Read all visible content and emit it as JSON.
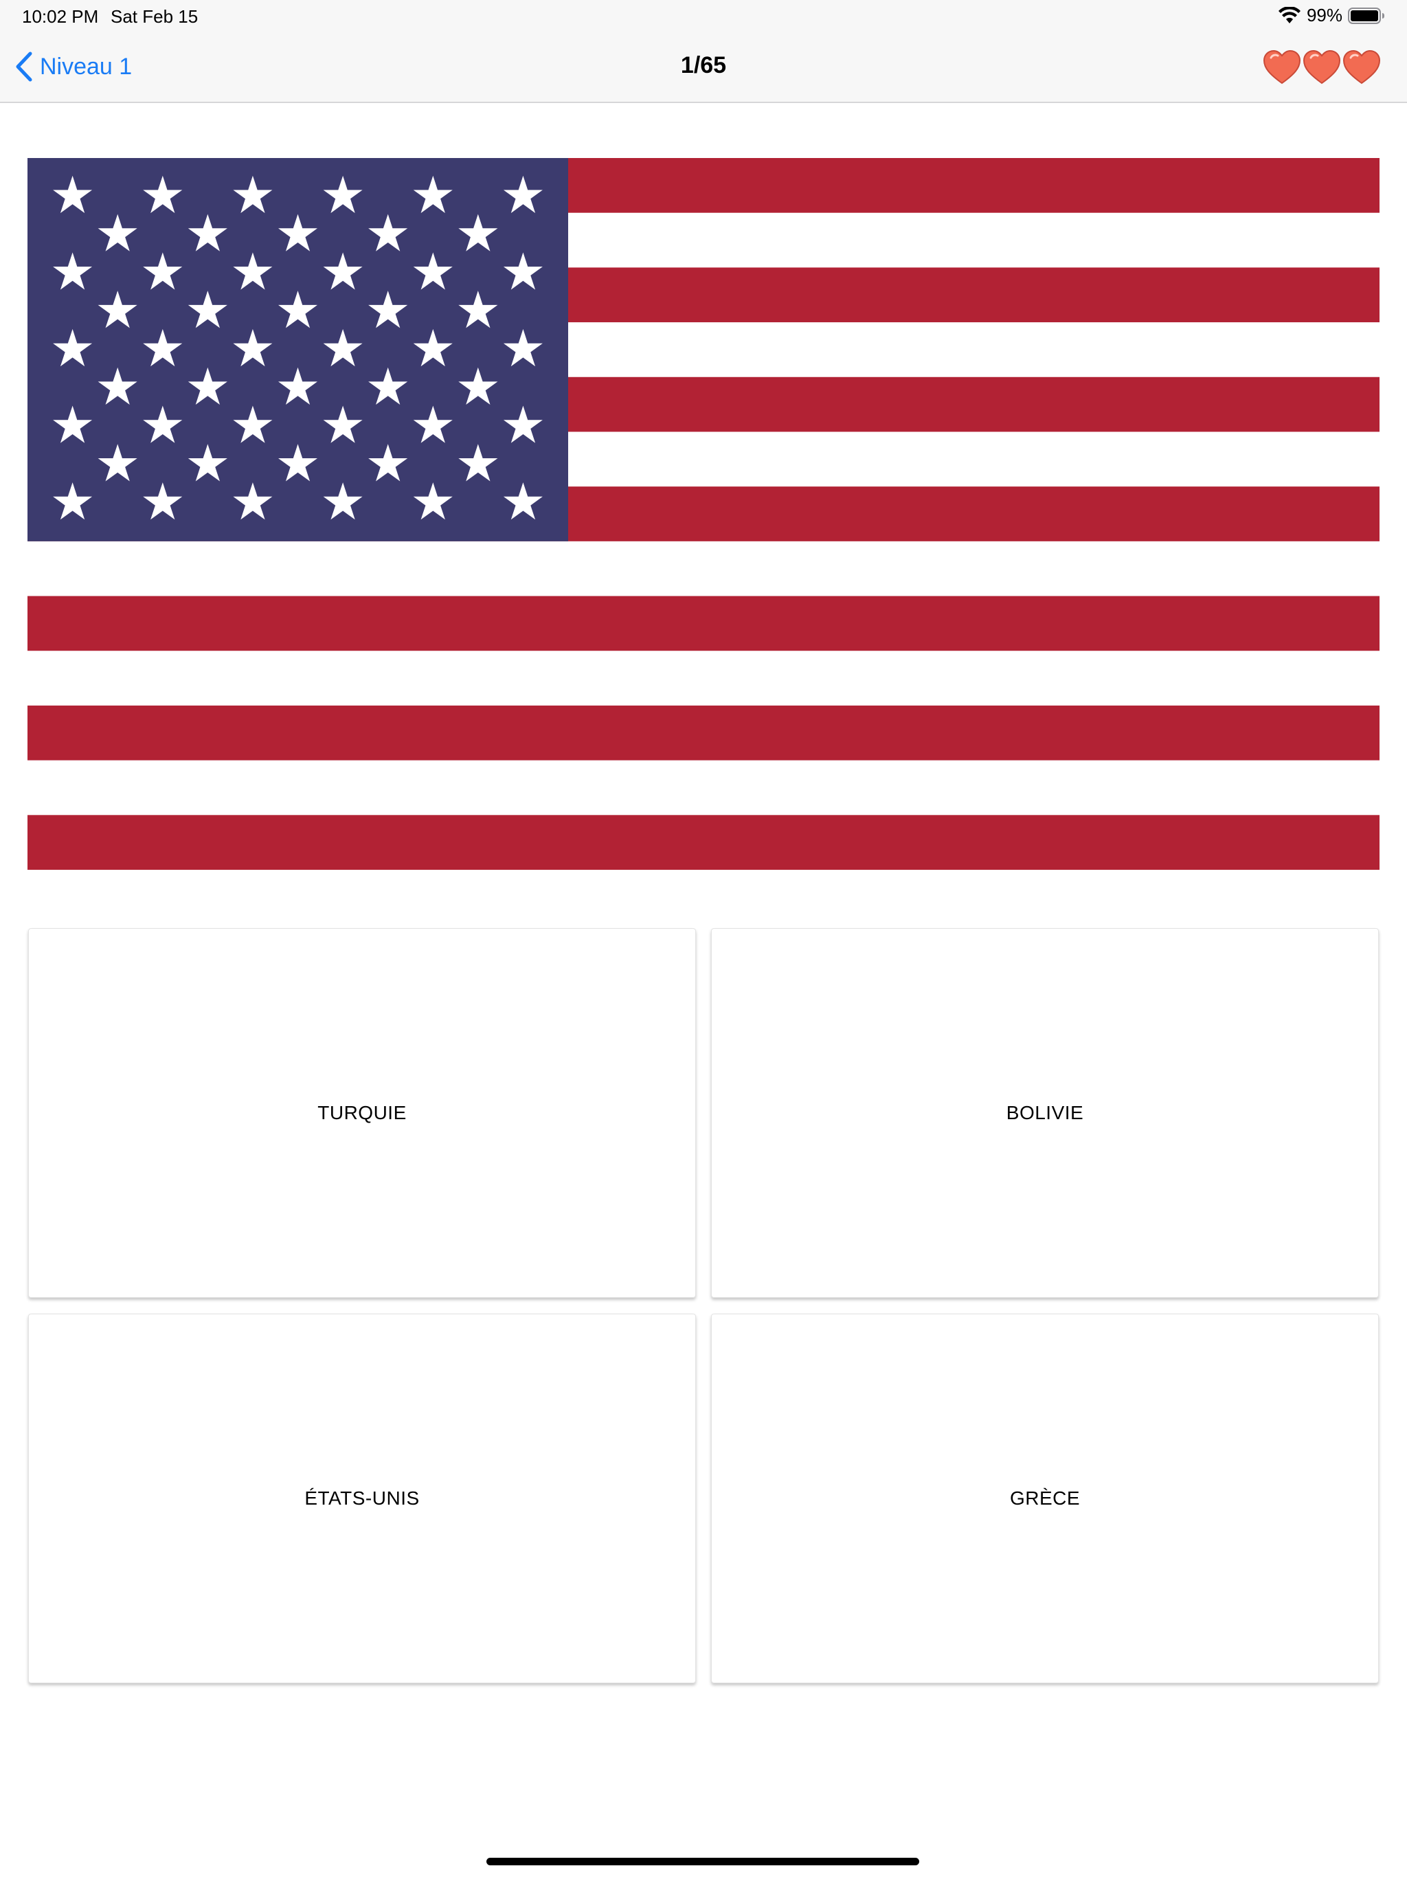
{
  "status_bar": {
    "time": "10:02 PM",
    "date": "Sat Feb 15",
    "battery": "99%"
  },
  "nav": {
    "back_label": "Niveau 1",
    "title": "1/65",
    "lives": 3
  },
  "flag": {
    "icon": "usa-flag",
    "colors": {
      "red": "#b22234",
      "white": "#ffffff",
      "blue": "#3c3b6e"
    }
  },
  "answers": [
    {
      "label": "TURQUIE"
    },
    {
      "label": "BOLIVIE"
    },
    {
      "label": "ÉTATS-UNIS"
    },
    {
      "label": "GRÈCE"
    }
  ],
  "colors": {
    "accent": "#1a7cf5",
    "heart": "#f26b52"
  }
}
